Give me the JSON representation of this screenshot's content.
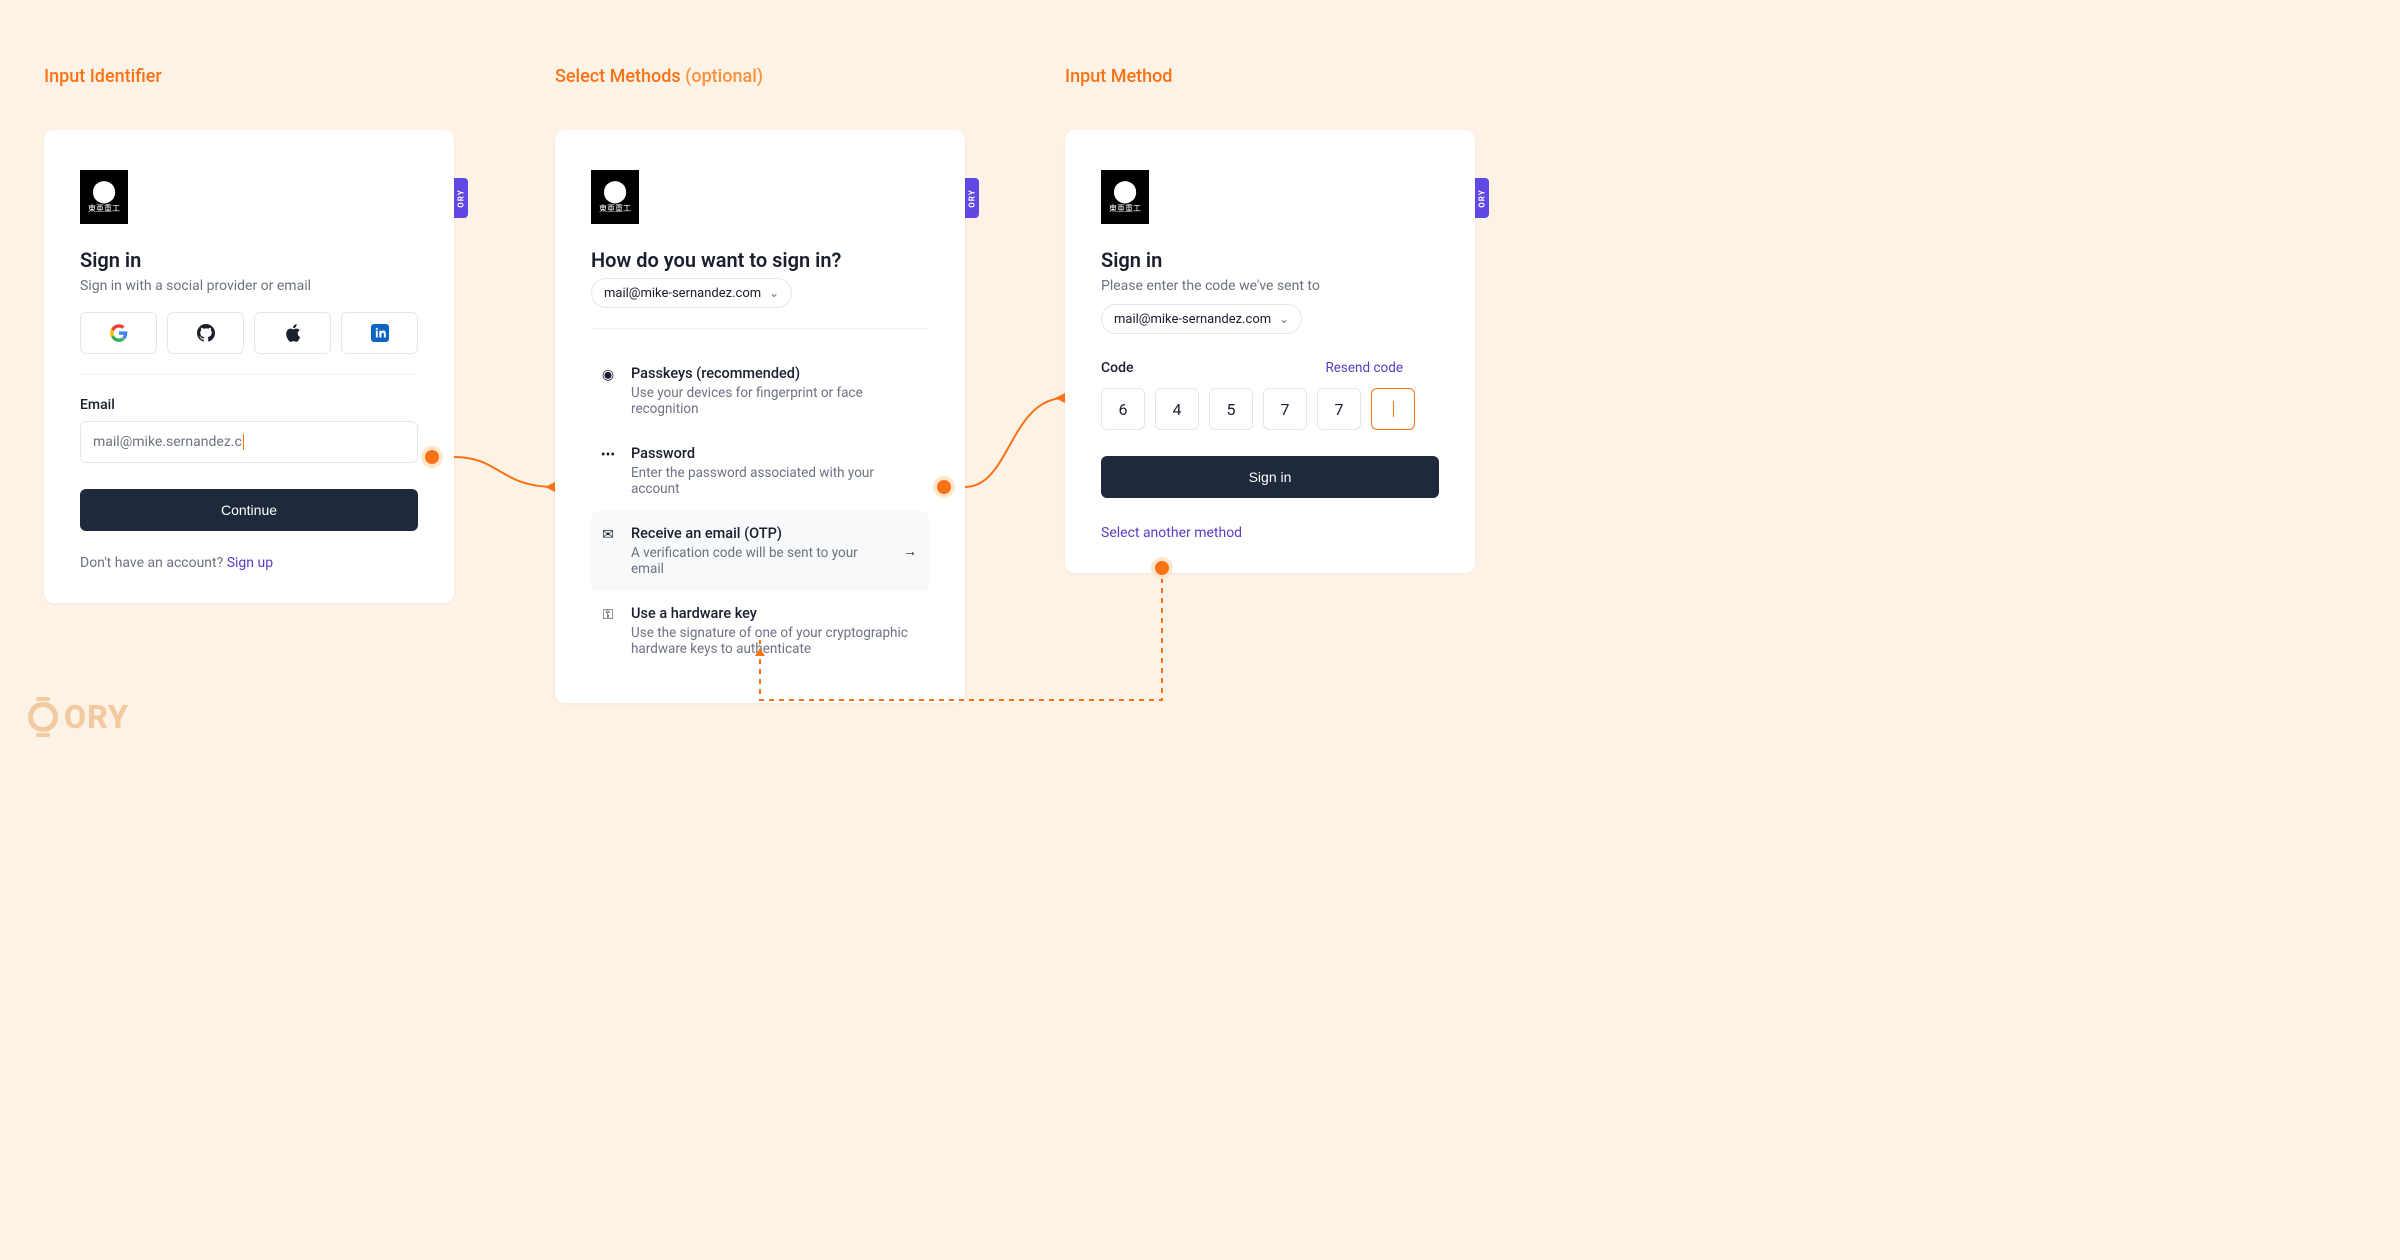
{
  "titles": {
    "step1": "Input Identifier",
    "step2": "Select Methods",
    "step2_suffix": "(optional)",
    "step3": "Input Method"
  },
  "ory_badge": "ORY",
  "ory_logo_text": "ORY",
  "card1": {
    "heading": "Sign in",
    "sub": "Sign in with a social provider or email",
    "email_label": "Email",
    "email_value": "mail@mike.sernandez.c",
    "continue_label": "Continue",
    "footer_prompt": "Don't have an account? ",
    "footer_link": "Sign up"
  },
  "card2": {
    "heading": "How do you want to sign in?",
    "chip_value": "mail@mike-sernandez.com",
    "methods": [
      {
        "icon": "fingerprint-icon",
        "title": "Passkeys (recommended)",
        "desc": "Use your devices for fingerprint or face recognition"
      },
      {
        "icon": "dots-icon",
        "title": "Password",
        "desc": "Enter the password associated with your account"
      },
      {
        "icon": "mail-icon",
        "title": "Receive an email (OTP)",
        "desc": "A verification code will be sent to your email",
        "selected": true
      },
      {
        "icon": "key-icon",
        "title": "Use a hardware key",
        "desc": "Use the signature of one of your cryptographic hardware keys to authenticate"
      }
    ]
  },
  "card3": {
    "heading": "Sign in",
    "sub": "Please enter the code we've sent to",
    "chip_value": "mail@mike-sernandez.com",
    "code_label": "Code",
    "resend_label": "Resend code",
    "code_values": [
      "6",
      "4",
      "5",
      "7",
      "7",
      ""
    ],
    "submit_label": "Sign in",
    "another_label": "Select another method"
  }
}
